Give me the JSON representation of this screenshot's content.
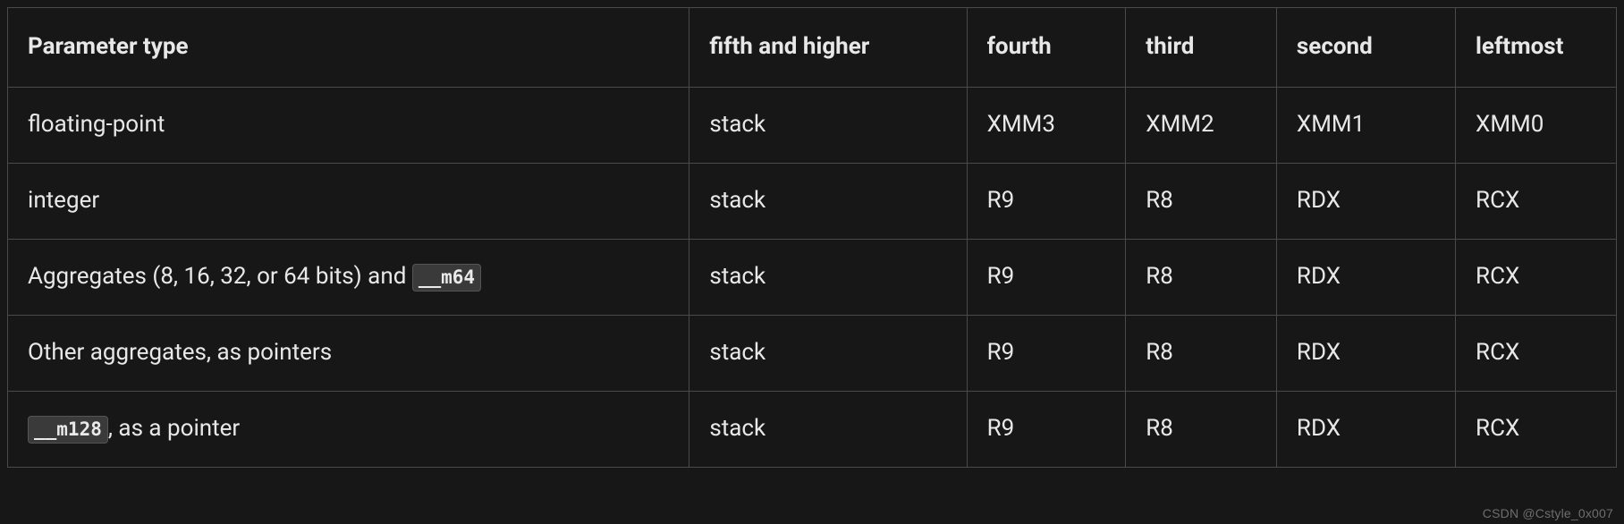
{
  "table": {
    "headers": [
      "Parameter type",
      "fifth and higher",
      "fourth",
      "third",
      "second",
      "leftmost"
    ],
    "rows": [
      {
        "param": [
          {
            "t": "text",
            "v": "floating-point"
          }
        ],
        "cells": [
          "stack",
          "XMM3",
          "XMM2",
          "XMM1",
          "XMM0"
        ]
      },
      {
        "param": [
          {
            "t": "text",
            "v": "integer"
          }
        ],
        "cells": [
          "stack",
          "R9",
          "R8",
          "RDX",
          "RCX"
        ]
      },
      {
        "param": [
          {
            "t": "text",
            "v": "Aggregates (8, 16, 32, or 64 bits) and "
          },
          {
            "t": "code",
            "v": "__m64"
          }
        ],
        "cells": [
          "stack",
          "R9",
          "R8",
          "RDX",
          "RCX"
        ]
      },
      {
        "param": [
          {
            "t": "text",
            "v": "Other aggregates, as pointers"
          }
        ],
        "cells": [
          "stack",
          "R9",
          "R8",
          "RDX",
          "RCX"
        ]
      },
      {
        "param": [
          {
            "t": "code",
            "v": "__m128"
          },
          {
            "t": "text",
            "v": ", as a pointer"
          }
        ],
        "cells": [
          "stack",
          "R9",
          "R8",
          "RDX",
          "RCX"
        ]
      }
    ]
  },
  "watermark": "CSDN @Cstyle_0x007"
}
